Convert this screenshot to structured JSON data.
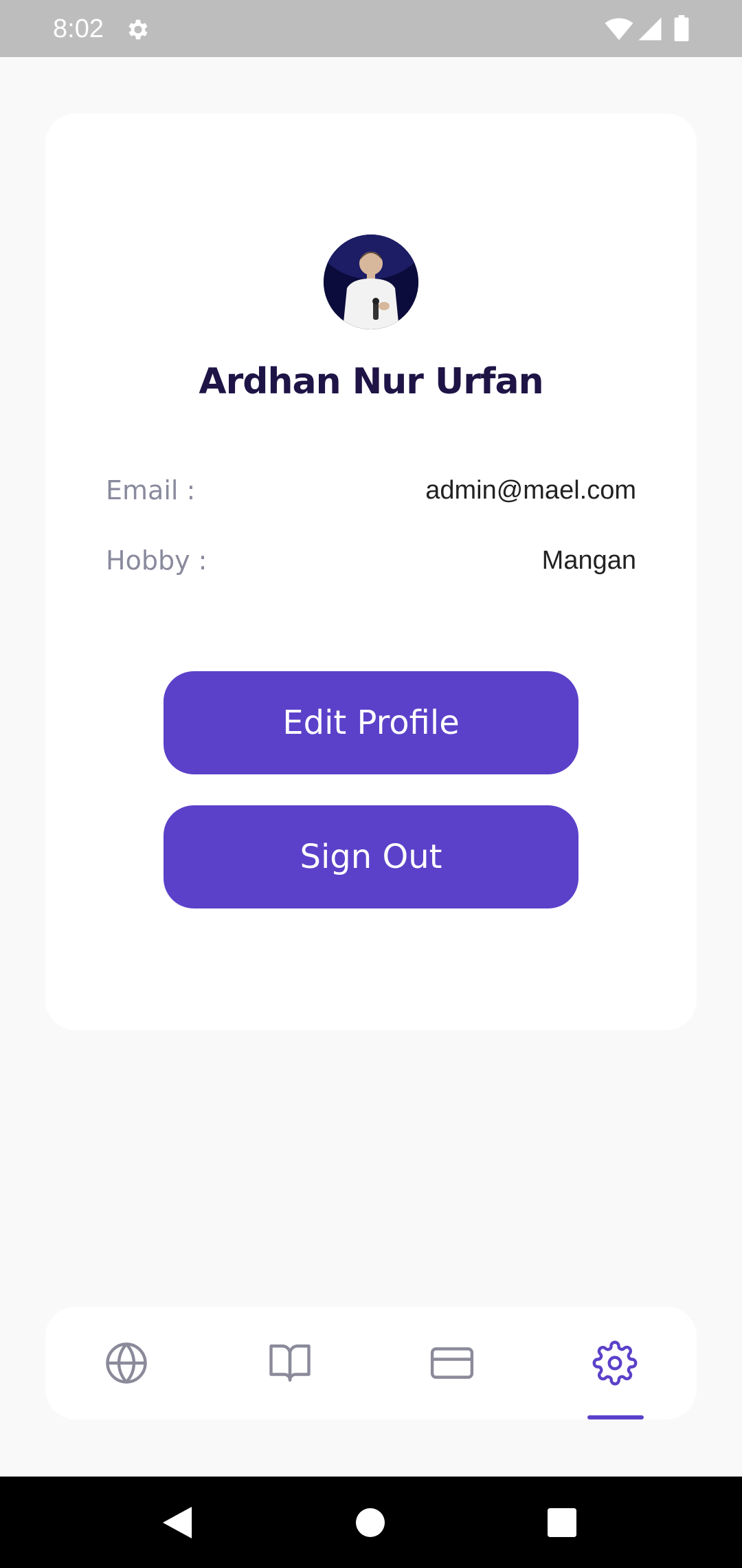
{
  "status_bar": {
    "time": "8:02",
    "icons": [
      "settings-gear-icon",
      "wifi-icon",
      "cell-signal-icon",
      "battery-icon"
    ]
  },
  "profile": {
    "name": "Ardhan Nur Urfan",
    "avatar_icon": "profile-photo",
    "fields": {
      "email_label": "Email :",
      "email_value": "admin@mael.com",
      "hobby_label": "Hobby :",
      "hobby_value": "Mangan"
    }
  },
  "actions": {
    "edit_profile_label": "Edit Profile",
    "sign_out_label": "Sign Out"
  },
  "bottom_nav": {
    "items": [
      {
        "icon": "globe-icon",
        "active": false
      },
      {
        "icon": "book-icon",
        "active": false
      },
      {
        "icon": "credit-card-icon",
        "active": false
      },
      {
        "icon": "settings-icon",
        "active": true
      }
    ]
  },
  "system_nav": {
    "icons": [
      "back-icon",
      "home-icon",
      "recents-icon"
    ]
  },
  "colors": {
    "accent": "#5b41c9",
    "name_text": "#1f1446",
    "label_text": "#8a8a9e",
    "value_text": "#222222",
    "inactive_icon": "#8a8a9a",
    "background": "#f9f9f9",
    "status_bar": "#bdbdbd",
    "system_nav": "#000000"
  }
}
